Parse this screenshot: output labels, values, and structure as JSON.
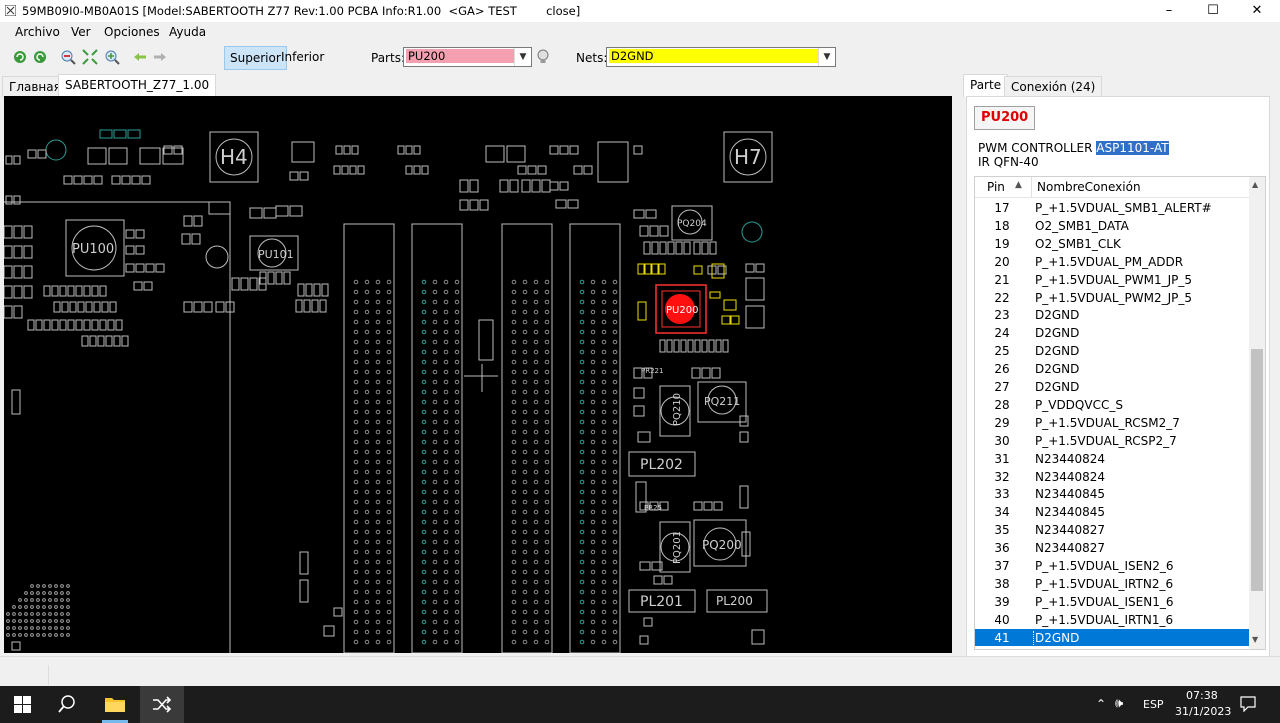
{
  "window": {
    "title": "59MB09I0-MB0A01S [Model:SABERTOOTH Z77 Rev:1.00 PCBA Info:R1.00  <GA> TEST        close]",
    "controls": [
      "–",
      "☐",
      "✕"
    ]
  },
  "menu": [
    "Archivo",
    "Ver",
    "Opciones",
    "Ayuda"
  ],
  "toolbar": {
    "side_superior": "Superior",
    "side_inferior": "Inferior",
    "parts_label": "Parts:",
    "parts_value": "PU200",
    "nets_label": "Nets:",
    "nets_value": "D2GND",
    "parts_highlight": "#f4a0b0",
    "nets_highlight": "#ffff00"
  },
  "tabs": [
    "Главная",
    "SABERTOOTH_Z77_1.00"
  ],
  "board": {
    "labels": [
      "H4",
      "H7",
      "PU100",
      "PU101",
      "PU200",
      "PQ211",
      "PQ210",
      "PL202",
      "PQ201",
      "PQ200",
      "PL201",
      "PL200",
      "PQ204",
      "PR221",
      "PR25"
    ],
    "selected_part_color": "#ff0000",
    "net_pin_color": "#f0e000"
  },
  "panel": {
    "tabs": [
      "Parte",
      "Conexión (24)"
    ],
    "part_name": "PU200",
    "description_prefix": "PWM CONTROLLER ",
    "description_selected": "ASP1101-AT",
    "package": "IR QFN-40",
    "columns": [
      "Pin",
      "NombreConexión"
    ],
    "rows": [
      {
        "pin": "17",
        "net": "P_+1.5VDUAL_SMB1_ALERT#"
      },
      {
        "pin": "18",
        "net": "O2_SMB1_DATA"
      },
      {
        "pin": "19",
        "net": "O2_SMB1_CLK"
      },
      {
        "pin": "20",
        "net": "P_+1.5VDUAL_PM_ADDR"
      },
      {
        "pin": "21",
        "net": "P_+1.5VDUAL_PWM1_JP_5"
      },
      {
        "pin": "22",
        "net": "P_+1.5VDUAL_PWM2_JP_5"
      },
      {
        "pin": "23",
        "net": "D2GND"
      },
      {
        "pin": "24",
        "net": "D2GND"
      },
      {
        "pin": "25",
        "net": "D2GND"
      },
      {
        "pin": "26",
        "net": "D2GND"
      },
      {
        "pin": "27",
        "net": "D2GND"
      },
      {
        "pin": "28",
        "net": "P_VDDQVCC_S"
      },
      {
        "pin": "29",
        "net": "P_+1.5VDUAL_RCSM2_7"
      },
      {
        "pin": "30",
        "net": "P_+1.5VDUAL_RCSP2_7"
      },
      {
        "pin": "31",
        "net": "N23440824"
      },
      {
        "pin": "32",
        "net": "N23440824"
      },
      {
        "pin": "33",
        "net": "N23440845"
      },
      {
        "pin": "34",
        "net": "N23440845"
      },
      {
        "pin": "35",
        "net": "N23440827"
      },
      {
        "pin": "36",
        "net": "N23440827"
      },
      {
        "pin": "37",
        "net": "P_+1.5VDUAL_ISEN2_6"
      },
      {
        "pin": "38",
        "net": "P_+1.5VDUAL_IRTN2_6"
      },
      {
        "pin": "39",
        "net": "P_+1.5VDUAL_ISEN1_6"
      },
      {
        "pin": "40",
        "net": "P_+1.5VDUAL_IRTN1_6"
      },
      {
        "pin": "41",
        "net": "D2GND"
      }
    ],
    "selected_pin": "41"
  },
  "taskbar": {
    "lang": "ESP",
    "time": "07:38",
    "date": "31/1/2023"
  }
}
